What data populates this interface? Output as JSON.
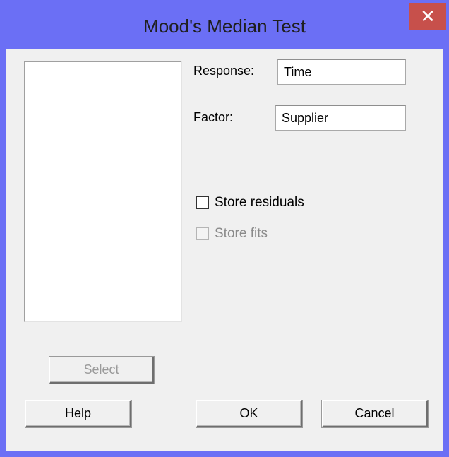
{
  "window": {
    "title": "Mood's Median Test",
    "close_glyph": "✕"
  },
  "form": {
    "response_label": "Response:",
    "response_value": "Time",
    "factor_label": "Factor:",
    "factor_value": "Supplier",
    "store_residuals_label": "Store residuals",
    "store_residuals_checked": false,
    "store_fits_label": "Store fits",
    "store_fits_checked": false,
    "store_fits_enabled": false
  },
  "buttons": {
    "select": "Select",
    "help": "Help",
    "ok": "OK",
    "cancel": "Cancel"
  },
  "colors": {
    "titlebar": "#6b6ff5",
    "close_button": "#c7504b",
    "dialog_background": "#f0f0f0"
  }
}
